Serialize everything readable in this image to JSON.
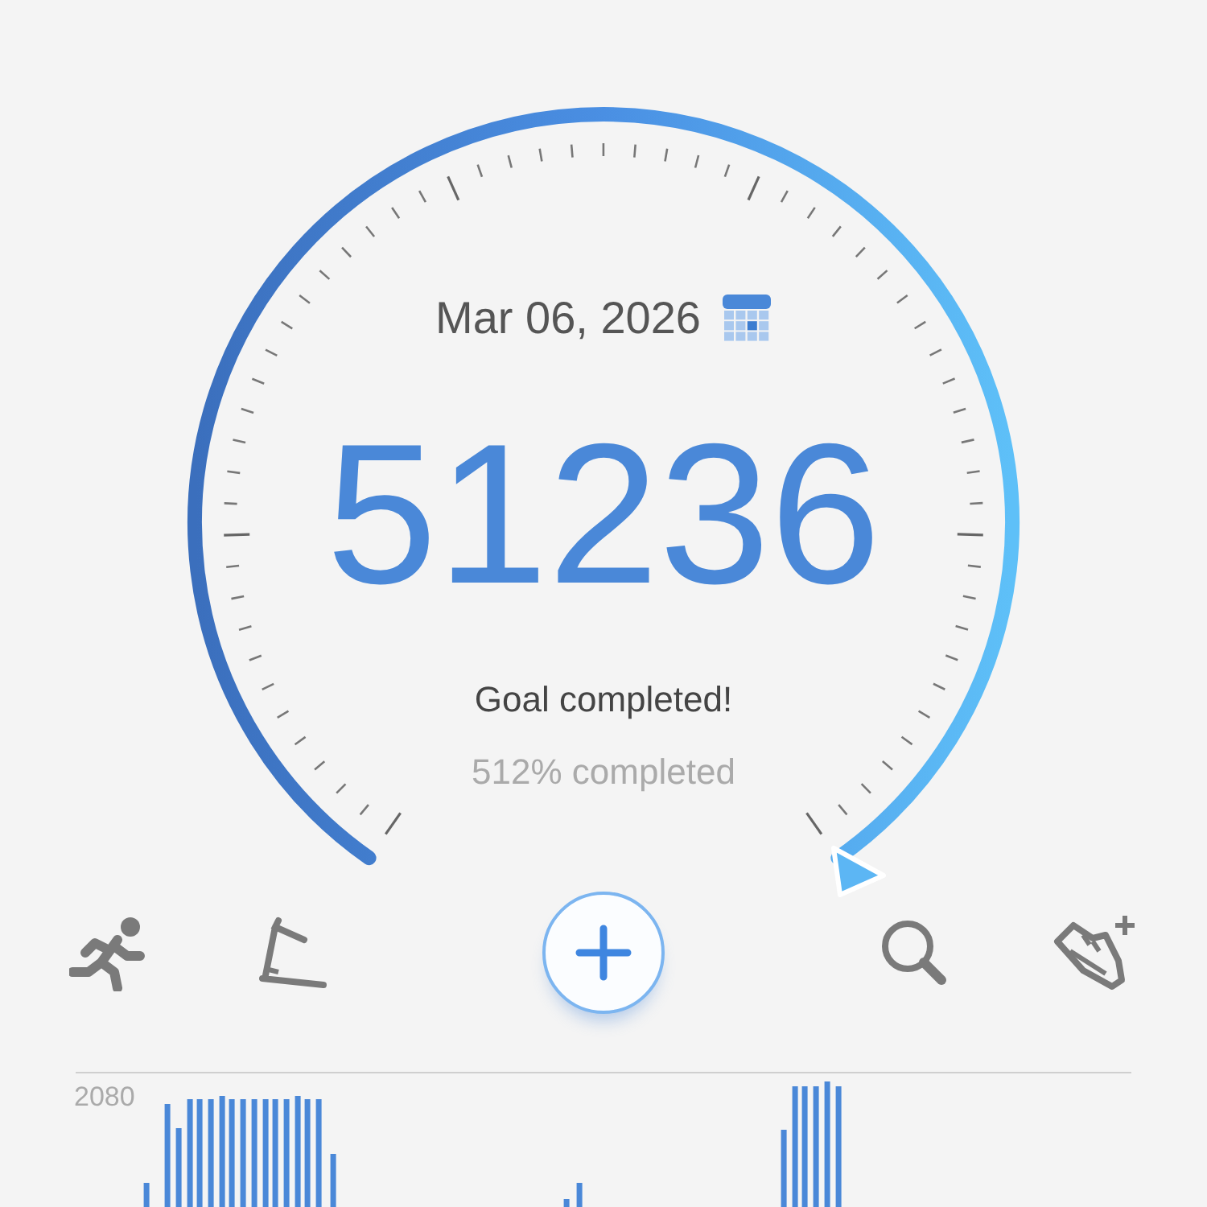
{
  "gauge": {
    "date": "Mar 06, 2026",
    "steps": "51236",
    "status": "Goal completed!",
    "percent": "512% completed"
  },
  "toolbar": [
    {
      "kind": "run"
    },
    {
      "kind": "treadmill"
    },
    {
      "kind": "add"
    },
    {
      "kind": "search"
    },
    {
      "kind": "shoe"
    }
  ],
  "chart": {
    "max_label": "2080"
  }
}
